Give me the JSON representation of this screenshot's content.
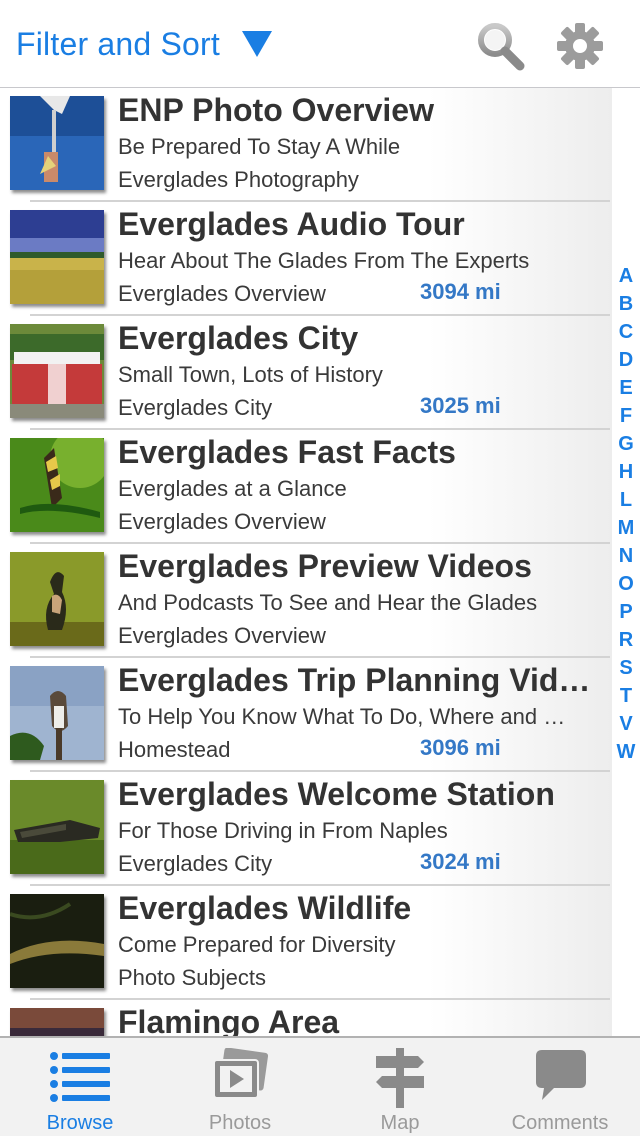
{
  "header": {
    "filter_label": "Filter and Sort",
    "accent_color": "#1a7ee3",
    "icons": [
      "search-icon",
      "gear-icon"
    ]
  },
  "rows": [
    {
      "title": "ENP Photo Overview",
      "subtitle": "Be Prepared To Stay A While",
      "category": "Everglades Photography",
      "distance": ""
    },
    {
      "title": "Everglades Audio Tour",
      "subtitle": "Hear About The Glades From The Experts",
      "category": "Everglades Overview",
      "distance": "3094 mi"
    },
    {
      "title": "Everglades City",
      "subtitle": " Small Town, Lots of History",
      "category": "Everglades City",
      "distance": "3025 mi"
    },
    {
      "title": "Everglades Fast Facts",
      "subtitle": "Everglades at a Glance",
      "category": "Everglades Overview",
      "distance": ""
    },
    {
      "title": "Everglades Preview Videos",
      "subtitle": "And Podcasts To See and Hear the Glades",
      "category": "Everglades Overview",
      "distance": ""
    },
    {
      "title": "Everglades Trip Planning Videos",
      "subtitle": "To Help You Know What To Do, Where and When",
      "category": "Homestead",
      "distance": "3096 mi"
    },
    {
      "title": "Everglades Welcome Station",
      "subtitle": "For Those Driving in From Naples",
      "category": "Everglades City",
      "distance": "3024 mi"
    },
    {
      "title": "Everglades Wildlife",
      "subtitle": "Come Prepared for Diversity",
      "category": "Photo Subjects",
      "distance": ""
    },
    {
      "title": "Flamingo Area",
      "subtitle": "",
      "category": "",
      "distance": ""
    }
  ],
  "index_letters": [
    "A",
    "B",
    "C",
    "D",
    "E",
    "F",
    "G",
    "H",
    "L",
    "M",
    "N",
    "O",
    "P",
    "R",
    "S",
    "T",
    "V",
    "W"
  ],
  "tabbar": {
    "tabs": [
      {
        "label": "Browse",
        "icon": "list-icon",
        "active": true
      },
      {
        "label": "Photos",
        "icon": "photos-icon",
        "active": false
      },
      {
        "label": "Map",
        "icon": "signpost-icon",
        "active": false
      },
      {
        "label": "Comments",
        "icon": "speech-bubble-icon",
        "active": false
      }
    ]
  }
}
